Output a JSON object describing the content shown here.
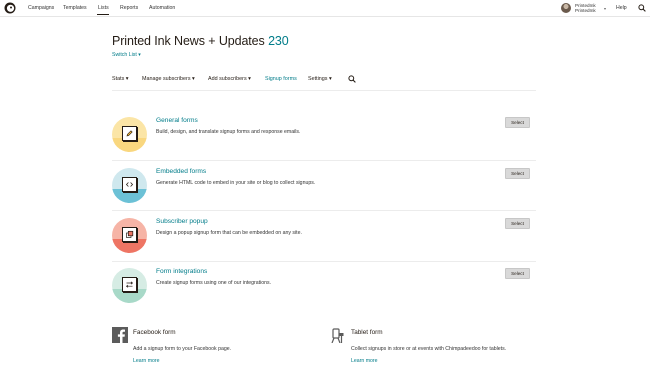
{
  "nav": {
    "items": [
      "Campaigns",
      "Templates",
      "Lists",
      "Reports",
      "Automation"
    ],
    "active": "Lists",
    "user_name": "PrintedInk",
    "user_subtitle": "PrintedInk",
    "help": "Help"
  },
  "header": {
    "title": "Printed Ink News + Updates",
    "count": "230",
    "switch_list": "Switch List"
  },
  "subnav": {
    "items": [
      {
        "label": "Stats",
        "has_dropdown": true
      },
      {
        "label": "Manage subscribers",
        "has_dropdown": true
      },
      {
        "label": "Add subscribers",
        "has_dropdown": true
      },
      {
        "label": "Signup forms",
        "has_dropdown": false,
        "active": true
      },
      {
        "label": "Settings",
        "has_dropdown": true
      }
    ]
  },
  "forms": [
    {
      "title": "General forms",
      "description": "Build, design, and translate signup forms and response emails.",
      "button": "Select",
      "icon": "pencil-icon",
      "color_top": "#fbe5a6",
      "color_bottom": "#f9d77f"
    },
    {
      "title": "Embedded forms",
      "description": "Generate HTML code to embed in your site or blog to collect signups.",
      "button": "Select",
      "icon": "code-icon",
      "color_top": "#cfe8ee",
      "color_bottom": "#6cc1d6"
    },
    {
      "title": "Subscriber popup",
      "description": "Design a popup signup form that can be embedded on any site.",
      "button": "Select",
      "icon": "popup-icon",
      "color_top": "#f6b4a6",
      "color_bottom": "#ee7564"
    },
    {
      "title": "Form integrations",
      "description": "Create signup forms using one of our integrations.",
      "button": "Select",
      "icon": "arrows-icon",
      "color_top": "#d6ece4",
      "color_bottom": "#a8d9c8"
    }
  ],
  "bottom": [
    {
      "title": "Facebook form",
      "description": "Add a signup form to your Facebook page.",
      "link": "Learn more",
      "icon": "facebook-icon"
    },
    {
      "title": "Tablet form",
      "description": "Collect signups in store or at events with Chimpadeedoo for tablets.",
      "link": "Learn more",
      "icon": "tablet-icon"
    }
  ],
  "colors": {
    "accent": "#007c89",
    "text": "#241c15"
  }
}
